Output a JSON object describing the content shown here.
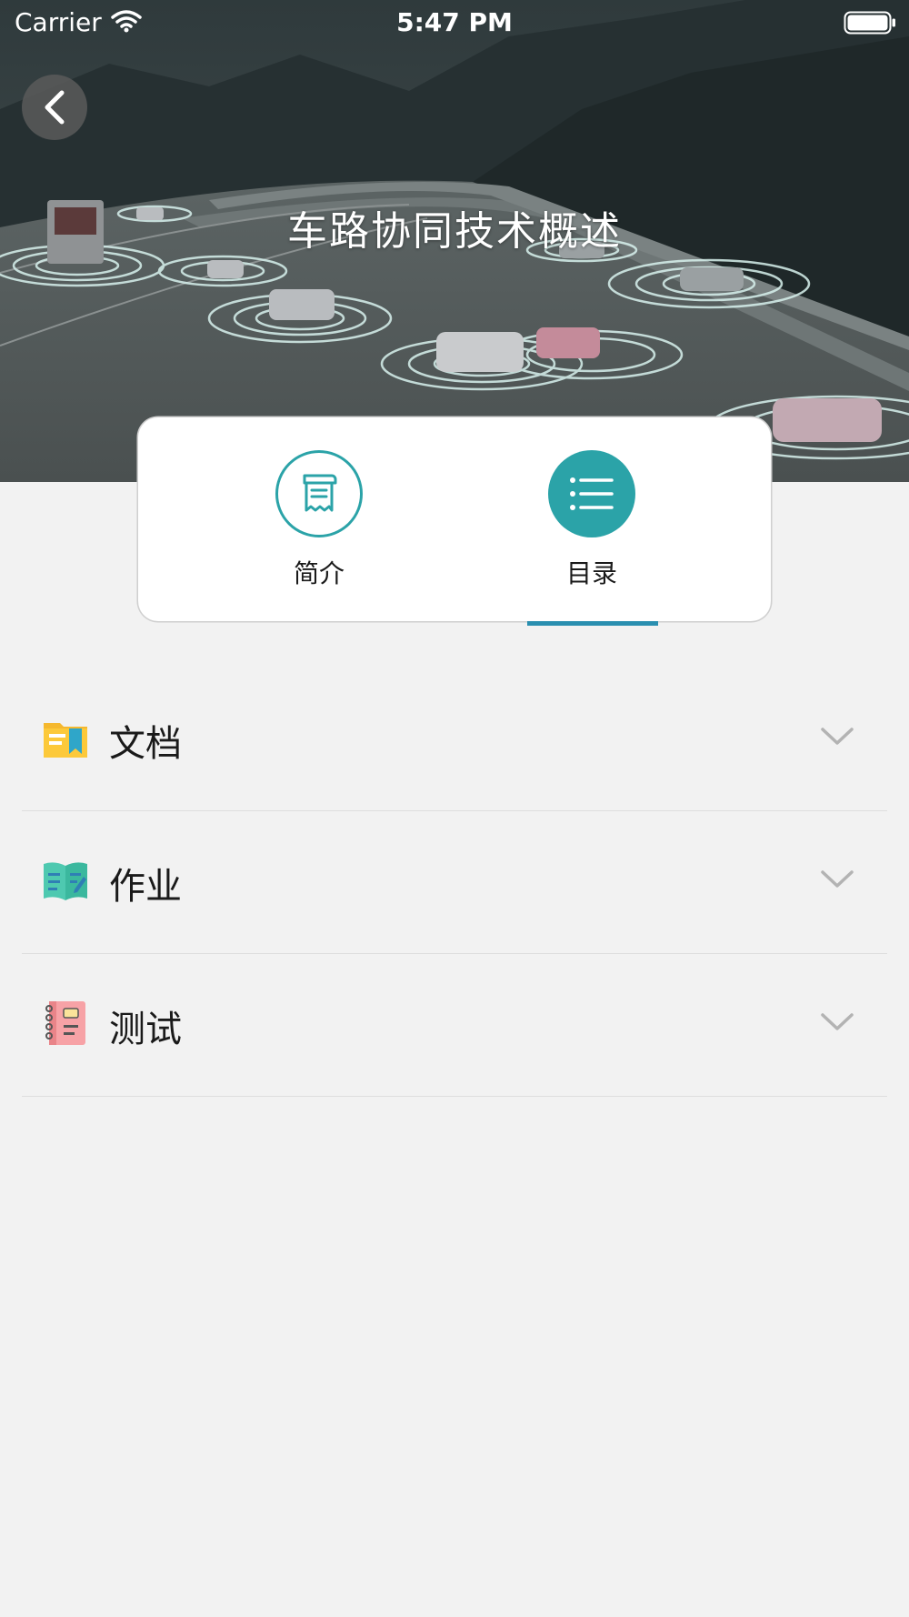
{
  "status_bar": {
    "carrier": "Carrier",
    "time": "5:47 PM"
  },
  "hero": {
    "title": "车路协同技术概述",
    "back_icon": "chevron-left-icon"
  },
  "tabs": [
    {
      "label": "简介",
      "icon": "scroll-document-icon",
      "active": false
    },
    {
      "label": "目录",
      "icon": "list-icon",
      "active": true
    }
  ],
  "sections": [
    {
      "label": "文档",
      "icon": "folder-bookmark-icon"
    },
    {
      "label": "作业",
      "icon": "open-book-pencil-icon"
    },
    {
      "label": "测试",
      "icon": "notebook-icon"
    }
  ],
  "colors": {
    "accent": "#2ba3a8",
    "underline": "#2a8fb0",
    "background": "#f2f2f2"
  }
}
